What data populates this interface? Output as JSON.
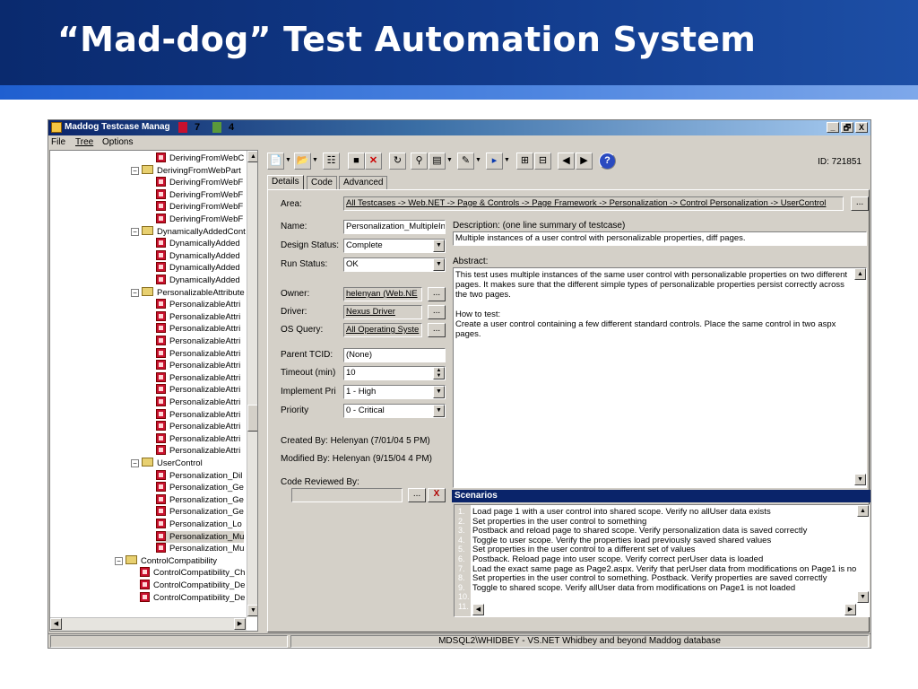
{
  "slide": {
    "title": "“Mad-dog” Test Automation System"
  },
  "window": {
    "title": "Maddog Testcase Manag",
    "count_a": "7",
    "count_b": "4",
    "controls": [
      "_",
      "🗗",
      "X"
    ]
  },
  "menu": [
    "File",
    "Tree",
    "Options"
  ],
  "tree": [
    {
      "label": "DerivingFromWebC",
      "type": "test",
      "indent": 118
    },
    {
      "label": "DerivingFromWebPart",
      "type": "folder",
      "indent": 90
    },
    {
      "label": "DerivingFromWebF",
      "type": "test",
      "indent": 118
    },
    {
      "label": "DerivingFromWebF",
      "type": "test",
      "indent": 118
    },
    {
      "label": "DerivingFromWebF",
      "type": "test",
      "indent": 118
    },
    {
      "label": "DerivingFromWebF",
      "type": "test",
      "indent": 118
    },
    {
      "label": "DynamicallyAddedCont",
      "type": "folder",
      "indent": 90
    },
    {
      "label": "DynamicallyAdded",
      "type": "test",
      "indent": 118
    },
    {
      "label": "DynamicallyAdded",
      "type": "test",
      "indent": 118
    },
    {
      "label": "DynamicallyAdded",
      "type": "test",
      "indent": 118
    },
    {
      "label": "DynamicallyAdded",
      "type": "test",
      "indent": 118
    },
    {
      "label": "PersonalizableAttribute",
      "type": "folder",
      "indent": 90
    },
    {
      "label": "PersonalizableAttri",
      "type": "test",
      "indent": 118
    },
    {
      "label": "PersonalizableAttri",
      "type": "test",
      "indent": 118
    },
    {
      "label": "PersonalizableAttri",
      "type": "test",
      "indent": 118
    },
    {
      "label": "PersonalizableAttri",
      "type": "test",
      "indent": 118
    },
    {
      "label": "PersonalizableAttri",
      "type": "test",
      "indent": 118
    },
    {
      "label": "PersonalizableAttri",
      "type": "test",
      "indent": 118
    },
    {
      "label": "PersonalizableAttri",
      "type": "test",
      "indent": 118
    },
    {
      "label": "PersonalizableAttri",
      "type": "test",
      "indent": 118
    },
    {
      "label": "PersonalizableAttri",
      "type": "test",
      "indent": 118
    },
    {
      "label": "PersonalizableAttri",
      "type": "test",
      "indent": 118
    },
    {
      "label": "PersonalizableAttri",
      "type": "test",
      "indent": 118
    },
    {
      "label": "PersonalizableAttri",
      "type": "test",
      "indent": 118
    },
    {
      "label": "PersonalizableAttri",
      "type": "test",
      "indent": 118
    },
    {
      "label": "UserControl",
      "type": "folder",
      "indent": 90
    },
    {
      "label": "Personalization_Dil",
      "type": "test",
      "indent": 118
    },
    {
      "label": "Personalization_Ge",
      "type": "test",
      "indent": 118
    },
    {
      "label": "Personalization_Ge",
      "type": "test",
      "indent": 118
    },
    {
      "label": "Personalization_Ge",
      "type": "test",
      "indent": 118
    },
    {
      "label": "Personalization_Lo",
      "type": "test",
      "indent": 118
    },
    {
      "label": "Personalization_Mu",
      "type": "test",
      "indent": 118,
      "selected": true
    },
    {
      "label": "Personalization_Mu",
      "type": "test",
      "indent": 118
    },
    {
      "label": "ControlCompatibility",
      "type": "folder",
      "indent": 72
    },
    {
      "label": "ControlCompatibility_Ch",
      "type": "test",
      "indent": 100
    },
    {
      "label": "ControlCompatibility_De",
      "type": "test",
      "indent": 100
    },
    {
      "label": "ControlCompatibility_De",
      "type": "test",
      "indent": 100
    }
  ],
  "toolbar": {
    "id_label": "ID: 721851"
  },
  "tabs": [
    "Details",
    "Code",
    "Advanced"
  ],
  "details": {
    "area_label": "Area:",
    "area_value": "All Testcases -> Web.NET -> Page & Controls -> Page Framework -> Personalization -> Control Personalization -> UserControl",
    "name_label": "Name:",
    "name_value": "Personalization_MultipleIn",
    "design_status_label": "Design Status:",
    "design_status_value": "Complete",
    "run_status_label": "Run Status:",
    "run_status_value": "OK",
    "owner_label": "Owner:",
    "owner_value": "helenyan (Web.NE",
    "driver_label": "Driver:",
    "driver_value": "Nexus Driver",
    "os_query_label": "OS Query:",
    "os_query_value": "All Operating Syste",
    "parent_tcid_label": "Parent TCID:",
    "parent_tcid_value": "(None)",
    "timeout_label": "Timeout (min)",
    "timeout_value": "10",
    "implement_pri_label": "Implement Pri",
    "implement_pri_value": "1 - High",
    "priority_label": "Priority",
    "priority_value": "0 - Critical",
    "created_by": "Created By: Helenyan (7/01/04 5 PM)",
    "modified_by": "Modified By: Helenyan (9/15/04 4 PM)",
    "code_reviewed_label": "Code Reviewed By:",
    "description_label": "Description: (one line summary of testcase)",
    "description_value": "Multiple instances of a user control with personalizable properties, diff pages.",
    "abstract_label": "Abstract:",
    "abstract_lines": [
      "This test uses multiple instances of the same user control with personalizable properties on two different",
      "pages. It makes sure that the different simple types of personalizable properties persist correctly across",
      "the two pages.",
      "",
      "How to test:",
      "Create a user control containing a few different standard controls. Place the same control in two aspx",
      "pages."
    ],
    "ellipsis": "...",
    "clear": "X"
  },
  "scenarios": {
    "header": "Scenarios",
    "numbers": [
      "1.",
      "2.",
      "3.",
      "4.",
      "5.",
      "6.",
      "7.",
      "8.",
      "9.",
      "10.",
      "11."
    ],
    "lines": [
      "Load page 1 with a user control into shared scope. Verify no allUser data exists",
      "Set properties in the user control to something",
      "Postback and reload page to shared scope. Verify personalization data is saved correctly",
      "Toggle to user scope. Verify the properties load previously saved shared values",
      "Set properties in the user control to a different set of values",
      "Postback. Reload page into user scope. Verify correct perUser data is loaded",
      "Load the exact same page as Page2.aspx. Verify that perUser data from modifications on Page1 is no",
      "Set properties in the user control to something. Postback. Verify properties are saved correctly",
      "Toggle to shared scope. Verify allUser data from modifications on Page1 is not loaded"
    ]
  },
  "status": {
    "database": "MDSQL2\\WHIDBEY - VS.NET Whidbey and beyond Maddog database"
  },
  "colors": {
    "slide_header": "#0a2a6e",
    "window_chrome": "#d4d0c8",
    "titlebar": "#0a246a",
    "test_icon": "#c8102e"
  }
}
